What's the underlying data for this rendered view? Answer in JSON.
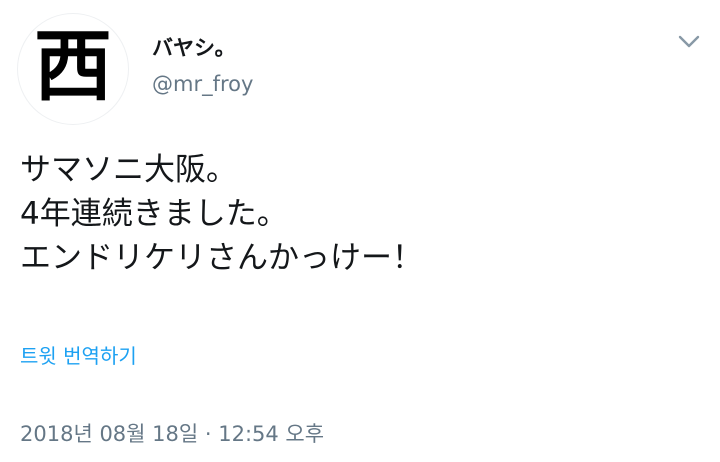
{
  "user": {
    "avatar_glyph": "西",
    "display_name": "バヤシ。",
    "handle": "@mr_froy"
  },
  "tweet": {
    "lines": [
      "サマソニ大阪。",
      "4年連続きました。",
      "エンドリケリさんかっけー！"
    ],
    "translate_label": "트윗 번역하기",
    "timestamp": "2018년 08월 18일 · 12:54 오후"
  },
  "icons": {
    "menu": "chevron-down-icon"
  },
  "colors": {
    "link": "#1da1f2",
    "secondary_text": "#657786",
    "primary_text": "#14171a"
  }
}
